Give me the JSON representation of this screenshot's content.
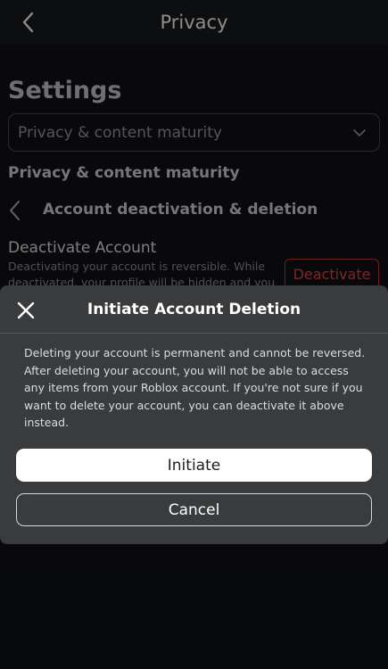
{
  "header": {
    "title": "Privacy",
    "back_icon": "chevron-left-icon"
  },
  "settings": {
    "heading": "Settings",
    "dropdown": {
      "selected": "Privacy & content maturity",
      "icon": "chevron-down-icon"
    },
    "section_title": "Privacy & content maturity",
    "subsection_title": "Account deactivation & deletion",
    "deactivate": {
      "title": "Deactivate Account",
      "description": "Deactivating your account is reversible. While deactivated, your profile will be hidden and you",
      "button_label": "Deactivate",
      "button_color": "#e04848"
    }
  },
  "modal": {
    "title": "Initiate Account Deletion",
    "close_icon": "close-icon",
    "body": "Deleting your account is permanent and cannot be reversed. After deleting your account, you will not be able to access any items from your Roblox account. If you're not sure if you want to delete your account, you can deactivate it above instead.",
    "primary_label": "Initiate",
    "secondary_label": "Cancel"
  },
  "colors": {
    "background": "#111214",
    "modal": "#393b3d",
    "primary_button": "#ffffff"
  }
}
